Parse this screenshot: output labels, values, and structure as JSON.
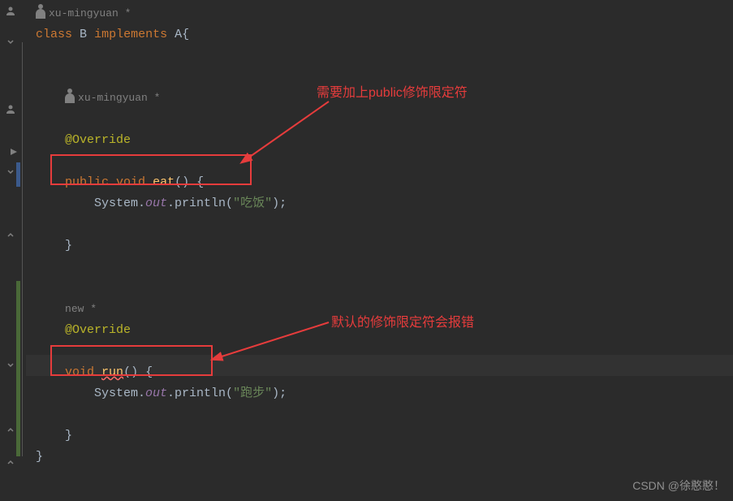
{
  "gutterHints": {
    "author1": "xu-mingyuan *",
    "author2": "xu-mingyuan *",
    "newHint": "new *"
  },
  "code": {
    "l1_class": "class",
    "l1_name": "B",
    "l1_impl": "implements",
    "l1_iface": "A",
    "l1_open": "{",
    "l3_ann": "@Override",
    "l4_pub": "public",
    "l4_void": "void",
    "l4_eat": "eat",
    "l4_sig": "() {",
    "l5_sys": "System.",
    "l5_out": "out",
    "l5_println": ".println(",
    "l5_str": "\"吃饭\"",
    "l5_end": ");",
    "l6_close": "}",
    "l8_ann": "@Override",
    "l9_void": "void",
    "l9_run": "run",
    "l9_sig": "() {",
    "l10_sys": "System.",
    "l10_out": "out",
    "l10_println": ".println(",
    "l10_str": "\"跑步\"",
    "l10_end": ");",
    "l11_close": "}",
    "l12_close": "}"
  },
  "annotations": {
    "top": "需要加上public修饰限定符",
    "bottom": "默认的修饰限定符会报错"
  },
  "watermark": "CSDN @徐憨憨！"
}
